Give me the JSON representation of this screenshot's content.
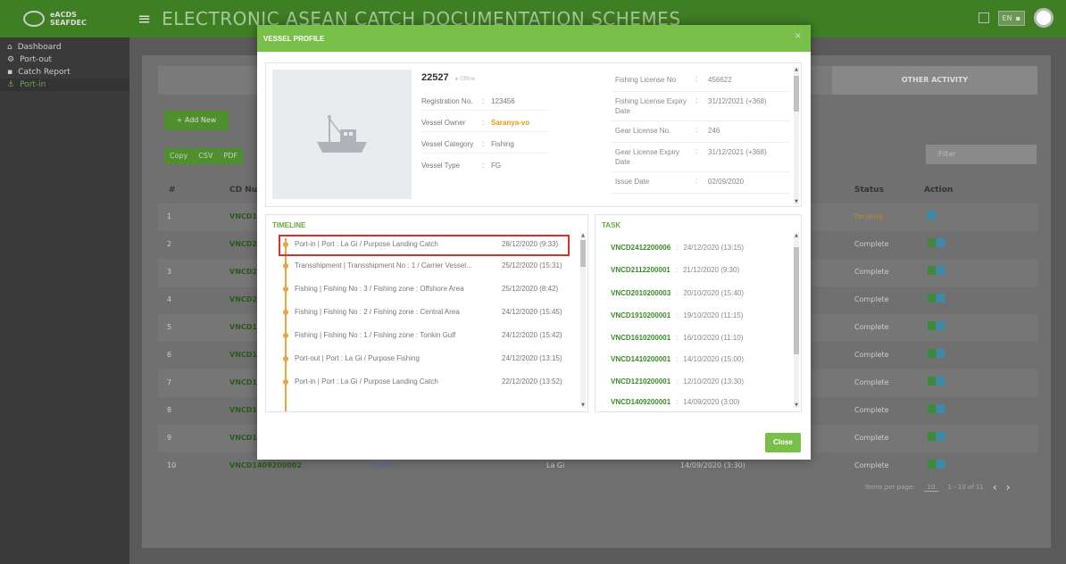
{
  "topbar": {
    "logo_line1": "eACDS",
    "logo_line2": "SEAFDEC",
    "app_title": "ELECTRONIC ASEAN CATCH DOCUMENTATION SCHEMES",
    "lang_en": "EN"
  },
  "sidebar": {
    "items": [
      {
        "icon": "home-icon",
        "label": "Dashboard"
      },
      {
        "icon": "gear-icon",
        "label": "Port-out"
      },
      {
        "icon": "document-icon",
        "label": "Catch Report"
      },
      {
        "icon": "anchor-icon",
        "label": "Port-in"
      }
    ]
  },
  "page": {
    "tab_other": "OTHER ACTIVITY",
    "add_new": "+ Add New",
    "export": [
      "Copy",
      "CSV",
      "PDF"
    ],
    "filter_placeholder": "Filter",
    "headers": {
      "num": "#",
      "cd": "CD Num",
      "status": "Status",
      "action": "Action"
    },
    "rows": [
      {
        "num": "1",
        "cd": "VNCD13",
        "status": "Pending"
      },
      {
        "num": "2",
        "cd": "VNCD24",
        "status": "Complete"
      },
      {
        "num": "3",
        "cd": "VNCD21",
        "status": "Complete"
      },
      {
        "num": "4",
        "cd": "VNCD20",
        "status": "Complete"
      },
      {
        "num": "5",
        "cd": "VNCD19",
        "status": "Complete"
      },
      {
        "num": "6",
        "cd": "VNCD16",
        "status": "Complete"
      },
      {
        "num": "7",
        "cd": "VNCD14",
        "status": "Complete"
      },
      {
        "num": "8",
        "cd": "VNCD12",
        "status": "Complete"
      },
      {
        "num": "9",
        "cd": "VNCD14",
        "status": "Complete"
      },
      {
        "num": "10",
        "cd": "VNCD1409200002",
        "status": "Complete",
        "vessel": "99999",
        "port": "La Gi",
        "date": "14/09/2020 (3:30)"
      }
    ],
    "pager": {
      "label": "Items per page:",
      "per_page": "10",
      "range": "1 - 10 of 11"
    }
  },
  "modal": {
    "title": "VESSEL PROFILE",
    "vessel_id": "22527",
    "vessel_status": "Offline",
    "fields": [
      {
        "k": "Registration No.",
        "v": "123456"
      },
      {
        "k": "Vessel Owner",
        "v": "Saranya-vo"
      },
      {
        "k": "Vessel Category",
        "v": "Fishing"
      },
      {
        "k": "Vessel Type",
        "v": "FG"
      }
    ],
    "licenses": [
      {
        "k": "Fishing License No",
        "v": "456622"
      },
      {
        "k": "Fishing License Expiry Date",
        "v": "31/12/2021 (+368)"
      },
      {
        "k": "Gear License No.",
        "v": "246"
      },
      {
        "k": "Gear License Expiry Date",
        "v": "31/12/2021 (+368)"
      },
      {
        "k": "Issue Date",
        "v": "02/09/2020"
      }
    ],
    "timeline_title": "TIMELINE",
    "timeline": [
      {
        "text": "Port-in | Port : La Gi / Purpose Landing Catch",
        "date": "28/12/2020 (9:33)"
      },
      {
        "text": "Transshipment | Transshipment No : 1 / Carrier Vessel...",
        "date": "25/12/2020 (15:31)"
      },
      {
        "text": "Fishing | Fishing No : 3 / Fishing zone : Offshore Area",
        "date": "25/12/2020 (8:42)"
      },
      {
        "text": "Fishing | Fishing No : 2 / Fishing zone : Central Area",
        "date": "24/12/2020 (15:45)"
      },
      {
        "text": "Fishing | Fishing No : 1 / Fishing zone : Tonkin Gulf",
        "date": "24/12/2020 (15:42)"
      },
      {
        "text": "Port-out | Port : La Gi / Purpose Fishing",
        "date": "24/12/2020 (13:15)"
      },
      {
        "text": "Port-in | Port : La Gi / Purpose Landing Catch",
        "date": "22/12/2020 (13:52)"
      }
    ],
    "task_title": "TASK",
    "tasks": [
      {
        "id": "VNCD2412200006",
        "date": "24/12/2020 (13:15)"
      },
      {
        "id": "VNCD2112200001",
        "date": "21/12/2020 (9:30)"
      },
      {
        "id": "VNCD2010200003",
        "date": "20/10/2020 (15:40)"
      },
      {
        "id": "VNCD1910200001",
        "date": "19/10/2020 (11:15)"
      },
      {
        "id": "VNCD1610200001",
        "date": "16/10/2020 (11:10)"
      },
      {
        "id": "VNCD1410200001",
        "date": "14/10/2020 (15:00)"
      },
      {
        "id": "VNCD1210200001",
        "date": "12/10/2020 (13:30)"
      },
      {
        "id": "VNCD1409200001",
        "date": "14/09/2020 (3:00)"
      }
    ],
    "close_label": "Close"
  }
}
